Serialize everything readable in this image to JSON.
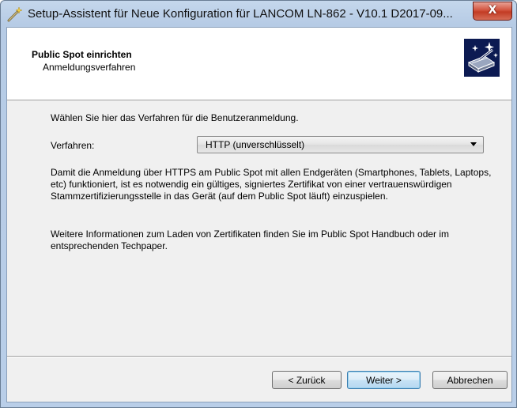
{
  "window": {
    "title": "Setup-Assistent für Neue Konfiguration für LANCOM LN-862 - V10.1 D2017-09...",
    "close_label": "X"
  },
  "header": {
    "title": "Public Spot einrichten",
    "subtitle": "Anmeldungsverfahren",
    "logo_icon": "wizard-wand-icon"
  },
  "content": {
    "intro": "Wählen Sie hier das Verfahren für die Benutzeranmeldung.",
    "verfahren_label": "Verfahren:",
    "verfahren_selected": "HTTP (unverschlüsselt)",
    "paragraph1": "Damit die Anmeldung über HTTPS am Public Spot mit allen Endgeräten (Smartphones, Tablets, Laptops, etc) funktioniert, ist es notwendig ein gültiges, signiertes Zertifikat von einer vertrauenswürdigen Stammzertifizierungsstelle in das Gerät (auf dem Public Spot läuft) einzuspielen.",
    "paragraph2": "Weitere Informationen zum Laden von Zertifikaten finden Sie im Public Spot Handbuch oder im entsprechenden Techpaper."
  },
  "buttons": {
    "back": "< Zurück",
    "next": "Weiter >",
    "cancel": "Abbrechen"
  },
  "colors": {
    "title_bar": "#b9cee8",
    "close_button": "#c23b24",
    "logo_background": "#0c1a52",
    "dialog_background": "#f0f0f0",
    "default_button_border": "#3c7fb1"
  }
}
